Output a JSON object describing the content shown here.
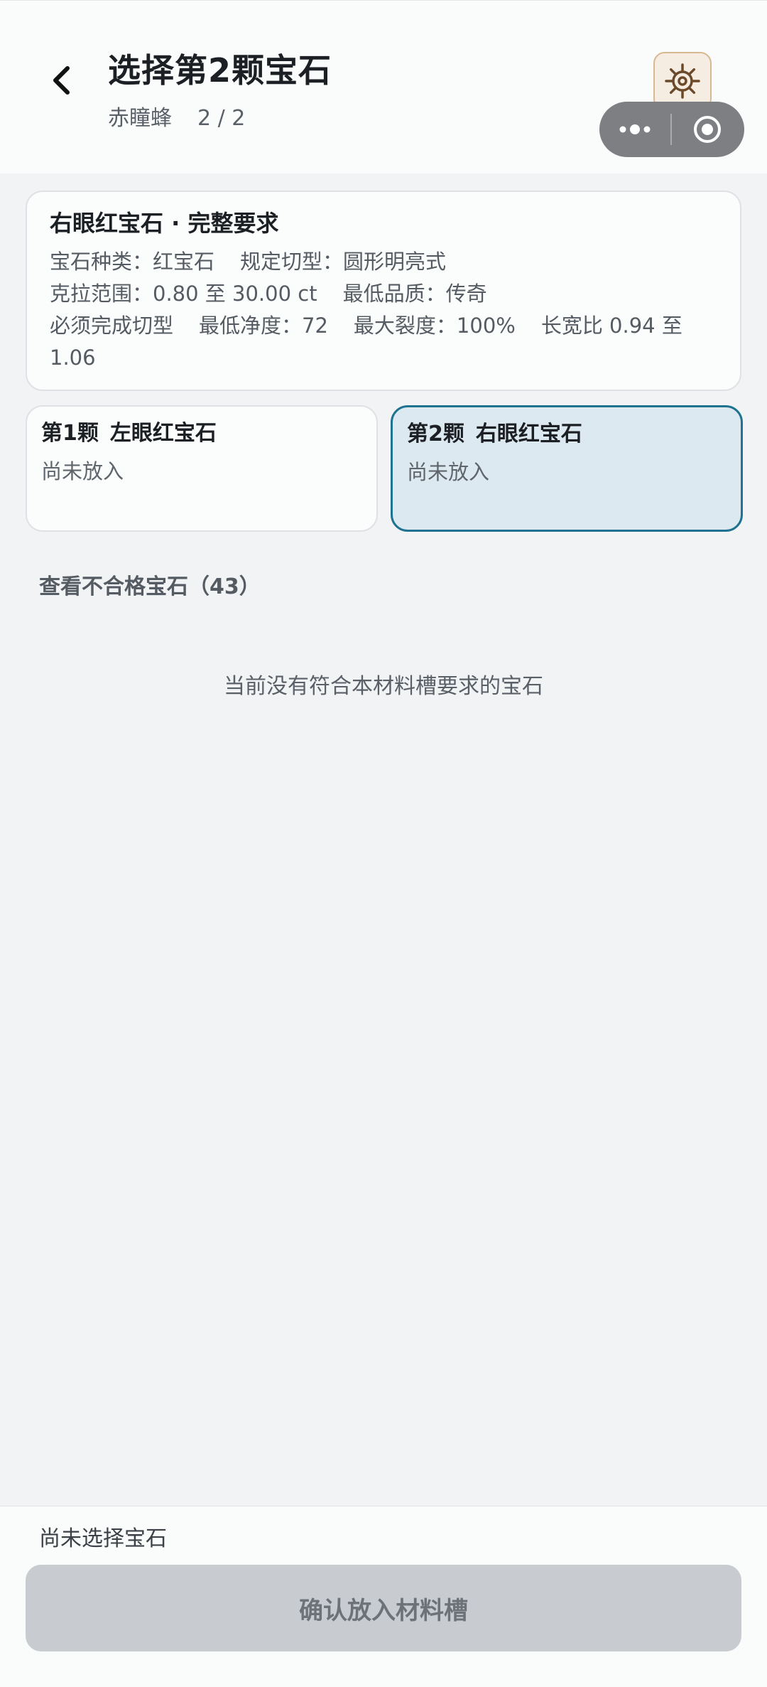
{
  "header": {
    "title": "选择第2颗宝石",
    "subtitle_name": "赤瞳蜂",
    "subtitle_count": "2 / 2"
  },
  "requirements": {
    "title": "右眼红宝石 · 完整要求",
    "gem_type": "宝石种类：红宝石",
    "cut": "规定切型：圆形明亮式",
    "carat_range": "克拉范围：0.80 至 30.00 ct",
    "min_quality": "最低品质：传奇",
    "must_finish_cut": "必须完成切型",
    "min_clarity": "最低净度：72",
    "max_crack": "最大裂度：100%",
    "aspect_ratio": "长宽比 0.94 至 1.06"
  },
  "slots": [
    {
      "index": "第1颗",
      "name": "左眼红宝石",
      "status": "尚未放入",
      "selected": false
    },
    {
      "index": "第2颗",
      "name": "右眼红宝石",
      "status": "尚未放入",
      "selected": true
    }
  ],
  "view_unqualified": "查看不合格宝石（43）",
  "empty_message": "当前没有符合本材料槽要求的宝石",
  "footer": {
    "status": "尚未选择宝石",
    "confirm_label": "确认放入材料槽"
  },
  "colors": {
    "selected_border": "#1f7390",
    "selected_bg": "#dde9f0",
    "disabled_button": "#c8ccd0"
  },
  "icons": {
    "back": "chevron-left-icon",
    "settings": "gear-icon",
    "more": "more-dots-icon",
    "close": "target-close-icon"
  }
}
